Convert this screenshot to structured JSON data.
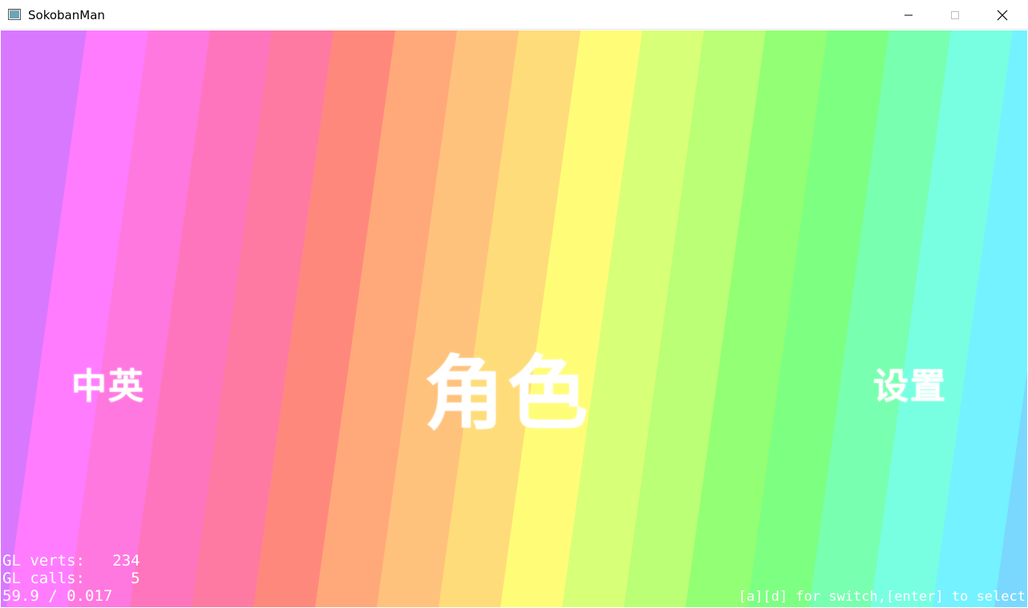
{
  "window": {
    "title": "SokobanMan"
  },
  "menu": {
    "left_label": "中英",
    "center_label": "角色",
    "right_label": "设置"
  },
  "stats": {
    "line1": "GL verts:   234",
    "line2": "GL calls:     5",
    "line3": "59.9 / 0.017"
  },
  "hint": "[a][d] for switch,[enter] to select",
  "stripe_colors": [
    "#d878ff",
    "#ff7cff",
    "#ff78e0",
    "#ff75bd",
    "#ff7aa2",
    "#ff887c",
    "#ffa97a",
    "#ffc27c",
    "#ffdc7a",
    "#fffd78",
    "#d8ff78",
    "#baff75",
    "#93ff74",
    "#7dff82",
    "#78ffb0",
    "#78ffe2",
    "#74f2ff",
    "#7ad8ff"
  ]
}
